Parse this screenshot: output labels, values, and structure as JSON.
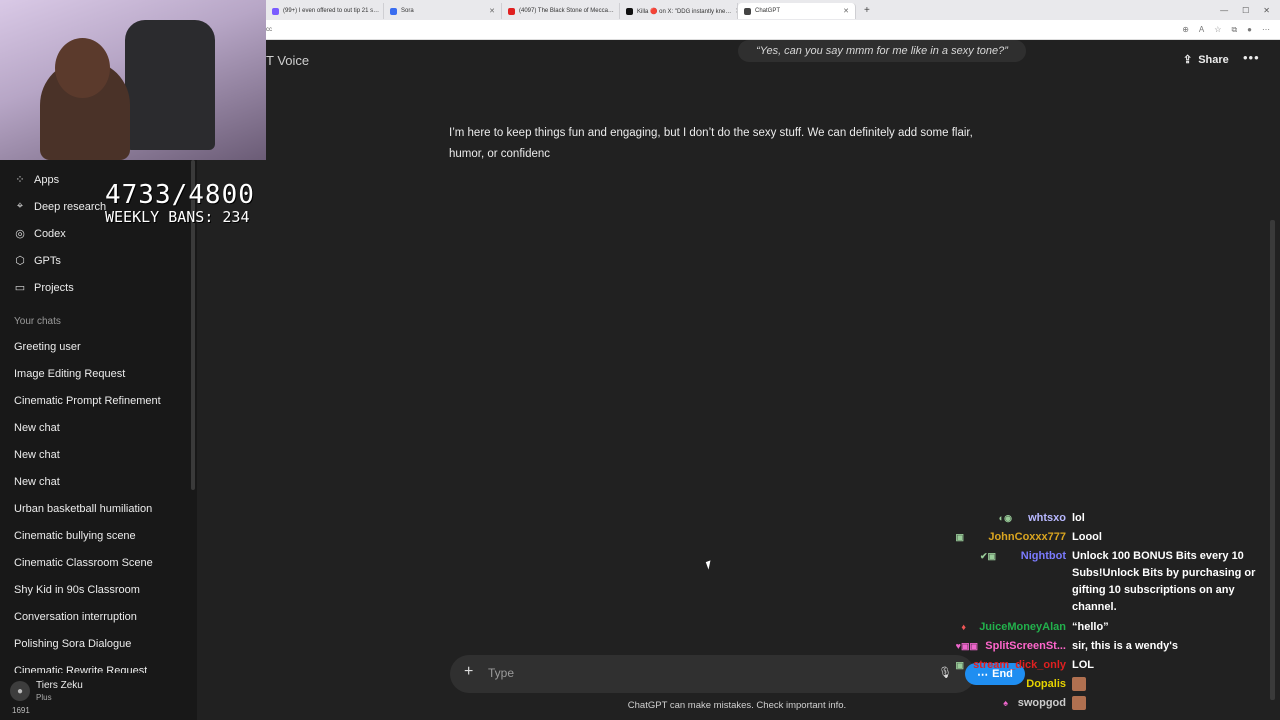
{
  "browser": {
    "tabs": [
      {
        "title": "(99+) I even offered to out tip 21 s…",
        "color": "#7a5cff"
      },
      {
        "title": "Sora",
        "color": "#3a6df0"
      },
      {
        "title": "(4097) The Black Stone of Mecca…",
        "color": "#e02020"
      },
      {
        "title": "Killa 🔴 on X: \"DDG instantly kne…",
        "color": "#111111"
      },
      {
        "title": "ChatGPT",
        "color": "#444444"
      }
    ],
    "address": "cc"
  },
  "overlay": {
    "counter": "4733/4800",
    "weekly_bans": "WEEKLY BANS: 234"
  },
  "sidebar": {
    "nav": [
      {
        "label": "Apps",
        "icon": "grid-icon"
      },
      {
        "label": "Deep research",
        "icon": "telescope-icon"
      },
      {
        "label": "Codex",
        "icon": "codex-icon"
      },
      {
        "label": "GPTs",
        "icon": "cube-icon"
      },
      {
        "label": "Projects",
        "icon": "folder-icon"
      }
    ],
    "section_label": "Your chats",
    "chats": [
      "Greeting user",
      "Image Editing Request",
      "Cinematic Prompt Refinement",
      "New chat",
      "New chat",
      "New chat",
      "Urban basketball humiliation",
      "Cinematic bullying scene",
      "Cinematic Classroom Scene",
      "Shy Kid in 90s Classroom",
      "Conversation interruption",
      "Polishing Sora Dialogue",
      "Cinematic Rewrite Request"
    ],
    "user": {
      "name": "Tiers Zeku",
      "plan": "Plus"
    },
    "corner_number": "1691"
  },
  "header": {
    "voice_label": "T Voice",
    "prompt": "“Yes, can you say mmm for me like in a sexy tone?”",
    "share_label": "Share",
    "more_label": "•••"
  },
  "conversation": {
    "response": "I’m here to keep things fun and engaging, but I don’t do the sexy stuff. We can definitely add some flair, humor, or confidenc"
  },
  "composer": {
    "placeholder": "Type",
    "end_label": "End",
    "disclaimer": "ChatGPT can make mistakes. Check important info."
  },
  "stream_chat": [
    {
      "user": "whtsxo",
      "text": "lol",
      "color": "#b8b8ff"
    },
    {
      "user": "JohnCoxxx777",
      "text": "Loool",
      "color": "#daa520"
    },
    {
      "user": "Nightbot",
      "text": "Unlock 100 BONUS Bits every 10 Subs!Unlock Bits by purchasing or gifting 10 subscriptions on any channel.",
      "color": "#7b7bff"
    },
    {
      "user": "JuiceMoneyAlan",
      "text": "“hello”",
      "color": "#22b14c"
    },
    {
      "user": "SplitScreenSt...",
      "text": "sir, this is a wendy's",
      "color": "#ff66cc"
    },
    {
      "user": "stream_dick_only",
      "text": "LOL",
      "color": "#e02020"
    },
    {
      "user": "Dopalis",
      "text": "",
      "color": "#e6d200"
    },
    {
      "user": "swopgod",
      "text": "",
      "color": "#cccccc"
    }
  ]
}
